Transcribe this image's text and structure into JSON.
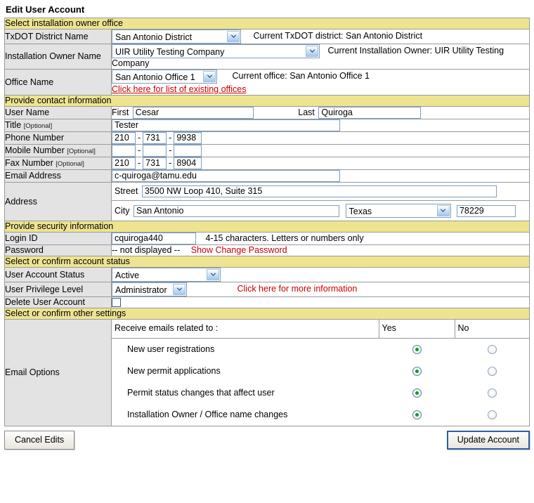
{
  "page": {
    "title": "Edit User Account"
  },
  "sections": {
    "owner_office": "Select installation owner office",
    "contact": "Provide contact information",
    "security": "Provide security information",
    "account_status": "Select or confirm account status",
    "other_settings": "Select or confirm other settings"
  },
  "owner_office": {
    "district": {
      "label": "TxDOT District Name",
      "selected": "San Antonio District",
      "current_text": "Current TxDOT district: San Antonio District"
    },
    "installation_owner": {
      "label": "Installation Owner Name",
      "selected": "UIR Utility Testing Company",
      "current_text": "Current Installation Owner: UIR Utility Testing Company"
    },
    "office": {
      "label": "Office Name",
      "selected": "San Antonio Office 1",
      "current_text": "Current office: San Antonio Office 1",
      "link": "Click here for list of existing offices"
    }
  },
  "contact": {
    "user_name": {
      "label": "User Name",
      "first_label": "First",
      "first_value": "Cesar",
      "last_label": "Last",
      "last_value": "Quiroga"
    },
    "title": {
      "label": "Title",
      "optional": "[Optional]",
      "value": "Tester"
    },
    "phone": {
      "label": "Phone Number",
      "area": "210",
      "prefix": "731",
      "line": "9938"
    },
    "mobile": {
      "label": "Mobile Number",
      "optional": "[Optional]",
      "area": "",
      "prefix": "",
      "line": ""
    },
    "fax": {
      "label": "Fax Number",
      "optional": "[Optional]",
      "area": "210",
      "prefix": "731",
      "line": "8904"
    },
    "email": {
      "label": "Email Address",
      "value": "c-quiroga@tamu.edu"
    },
    "address": {
      "label": "Address",
      "street_label": "Street",
      "street_value": "3500 NW Loop 410, Suite 315",
      "city_label": "City",
      "city_value": "San Antonio",
      "state_selected": "Texas",
      "zip_value": "78229"
    }
  },
  "security": {
    "login_id": {
      "label": "Login ID",
      "value": "cquiroga440",
      "hint": "4-15 characters. Letters or numbers only"
    },
    "password": {
      "label": "Password",
      "value": "-- not displayed --",
      "link": "Show Change Password"
    }
  },
  "account_status": {
    "status": {
      "label": "User Account Status",
      "selected": "Active"
    },
    "privilege": {
      "label": "User Privilege Level",
      "selected": "Administrator",
      "link": "Click here for more information"
    },
    "delete": {
      "label": "Delete User Account",
      "checked": false
    }
  },
  "email_options": {
    "label": "Email Options",
    "header": "Receive emails related to :",
    "yes_header": "Yes",
    "no_header": "No",
    "rows": [
      {
        "label": "New user registrations",
        "value": "Yes"
      },
      {
        "label": "New permit applications",
        "value": "Yes"
      },
      {
        "label": "Permit status changes that affect user",
        "value": "Yes"
      },
      {
        "label": "Installation Owner / Office name changes",
        "value": "Yes"
      }
    ]
  },
  "buttons": {
    "cancel": "Cancel Edits",
    "update": "Update Account"
  },
  "colors": {
    "section_bar": "#eee490",
    "label_cell": "#e3e3e3",
    "link_red": "#cc0000",
    "radio_green": "#0e9c2a",
    "input_border": "#7c9ec0"
  }
}
